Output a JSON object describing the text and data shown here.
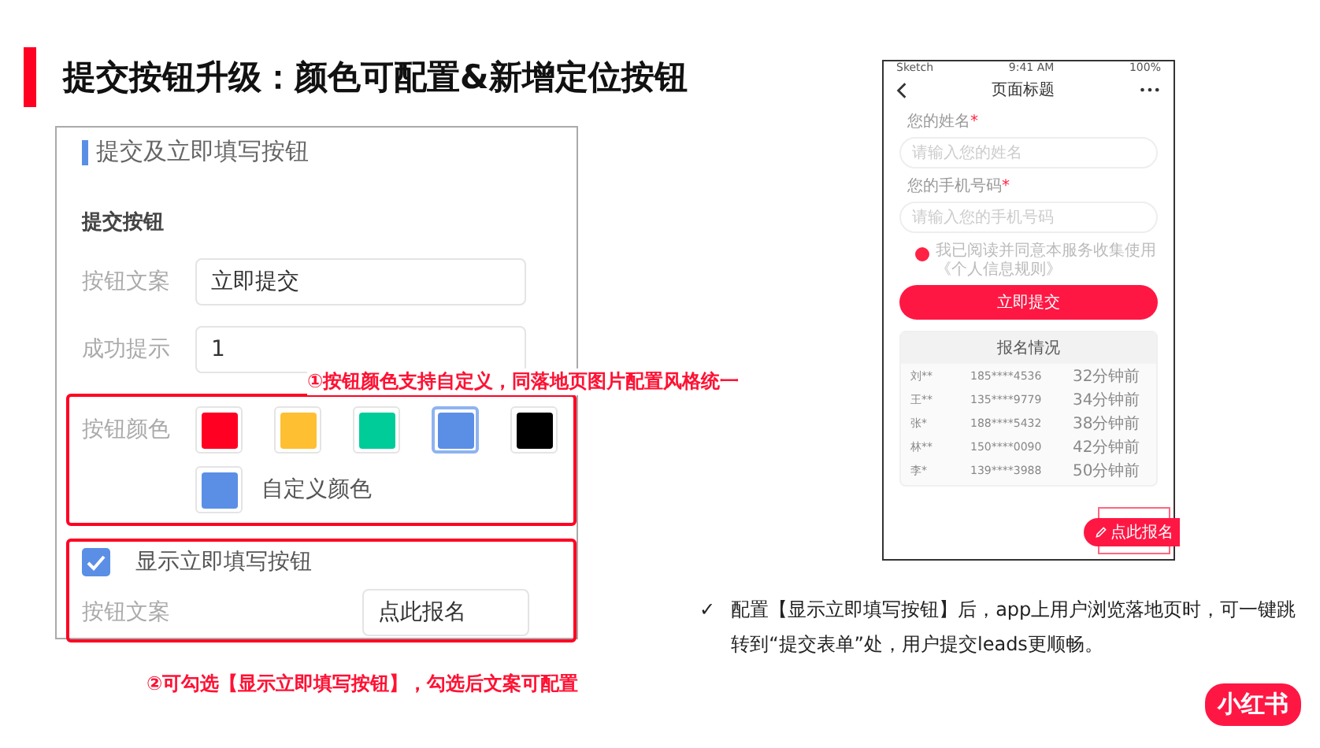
{
  "slide_title": "提交按钮升级：颜色可配置&新增定位按钮",
  "settings_panel": {
    "heading": "提交及立即填写按钮",
    "section_title": "提交按钮",
    "fields": [
      {
        "label": "按钮文案",
        "value": "立即提交"
      },
      {
        "label": "成功提示",
        "value": "1"
      }
    ],
    "color_label": "按钮颜色",
    "swatches": [
      {
        "color": "#ff0022",
        "selected": false
      },
      {
        "color": "#ffbf33",
        "selected": false
      },
      {
        "color": "#00cc99",
        "selected": false
      },
      {
        "color": "#5b8fe6",
        "selected": true
      },
      {
        "color": "#000000",
        "selected": false
      }
    ],
    "custom_color": {
      "color": "#5b8fe6",
      "label": "自定义颜色"
    },
    "show_fill_button": {
      "label": "显示立即填写按钮",
      "checked": true
    },
    "fill_button_field": {
      "label": "按钮文案",
      "value": "点此报名"
    }
  },
  "annotations": [
    "①按钮颜色支持自定义，同落地页图片配置风格统一",
    "②可勾选【显示立即填写按钮】，勾选后文案可配置"
  ],
  "phone": {
    "carrier": "Sketch",
    "time": "9:41 AM",
    "battery": "100%",
    "page_title": "页面标题",
    "more": "•••",
    "form_fields": [
      {
        "label": "您的姓名",
        "required_mark": "*",
        "placeholder": "请输入您的姓名"
      },
      {
        "label": "您的手机号码",
        "required_mark": "*",
        "placeholder": "请输入您的手机号码"
      }
    ],
    "consent": {
      "text": "我已阅读并同意本服务收集使用《个人信息规则》",
      "checked": true
    },
    "submit_button": "立即提交",
    "signup_table": {
      "title": "报名情况",
      "rows": [
        [
          "刘**",
          "185****4536",
          "32分钟前"
        ],
        [
          "王**",
          "135****9779",
          "34分钟前"
        ],
        [
          "张*",
          "188****5432",
          "38分钟前"
        ],
        [
          "林**",
          "150****0090",
          "42分钟前"
        ],
        [
          "李*",
          "139****3988",
          "50分钟前"
        ]
      ]
    },
    "floating_button": "点此报名"
  },
  "bullet": {
    "mark": "✓",
    "text": "配置【显示立即填写按钮】后，app上用户浏览落地页时，可一键跳转到“提交表单”处，用户提交leads更顺畅。"
  },
  "logo": "小红书"
}
